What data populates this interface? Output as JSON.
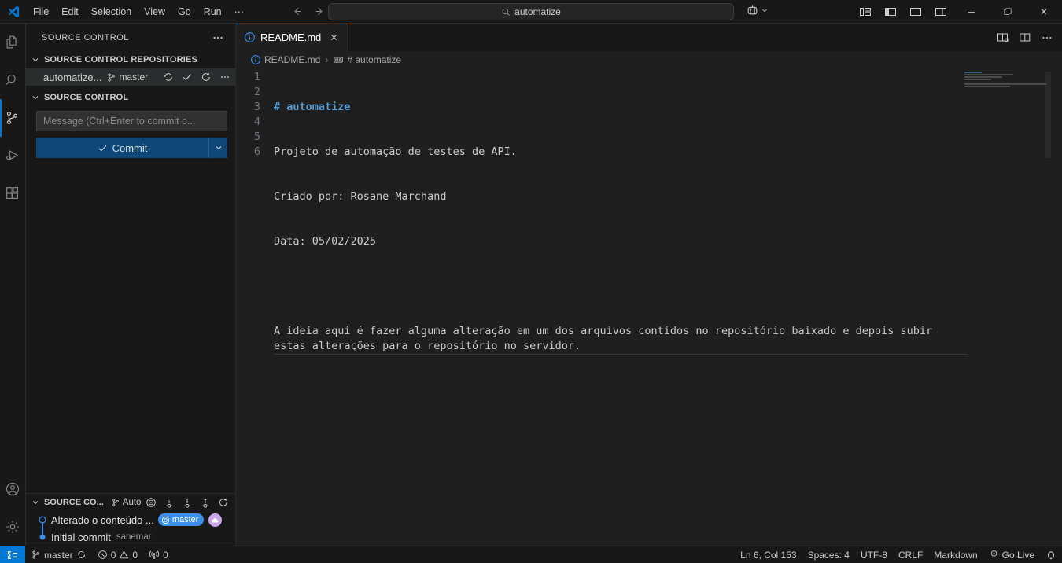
{
  "titlebar": {
    "logo_icon": "vscode-logo-icon",
    "menu": [
      {
        "label": "File"
      },
      {
        "label": "Edit"
      },
      {
        "label": "Selection"
      },
      {
        "label": "View"
      },
      {
        "label": "Go"
      },
      {
        "label": "Run"
      },
      {
        "label": "···"
      }
    ],
    "nav_back_icon": "arrow-left-icon",
    "nav_forward_icon": "arrow-right-icon",
    "command_center": {
      "icon": "search-icon",
      "value": "automatize",
      "placeholder": "Search"
    },
    "accounts_icon": "remote-explorer-icon",
    "accounts_chevron_icon": "chevron-down-icon",
    "layout_buttons": [
      {
        "name": "toggle-panel-layout-icon"
      },
      {
        "name": "toggle-primary-sidebar-icon"
      },
      {
        "name": "toggle-panel-icon"
      },
      {
        "name": "toggle-secondary-sidebar-icon"
      }
    ],
    "window_controls": [
      {
        "name": "minimize-button",
        "glyph": "─"
      },
      {
        "name": "maximize-button",
        "glyph": "❐"
      },
      {
        "name": "close-button",
        "glyph": "✕"
      }
    ]
  },
  "activitybar": {
    "items": [
      {
        "name": "explorer",
        "icon": "files-icon",
        "active": false
      },
      {
        "name": "search",
        "icon": "search-icon",
        "active": false
      },
      {
        "name": "source-control",
        "icon": "source-control-icon",
        "active": true
      },
      {
        "name": "run-and-debug",
        "icon": "debug-icon",
        "active": false
      },
      {
        "name": "extensions",
        "icon": "extensions-icon",
        "active": false
      }
    ],
    "bottom": [
      {
        "name": "accounts",
        "icon": "account-icon"
      },
      {
        "name": "manage",
        "icon": "gear-icon"
      }
    ]
  },
  "sidebar": {
    "title": "SOURCE CONTROL",
    "title_more_icon": "ellipsis-icon",
    "repositories_section": {
      "label": "SOURCE CONTROL REPOSITORIES",
      "chevron_icon": "chevron-down-icon",
      "repo": {
        "name": "automatize...",
        "branch": "master",
        "branch_icon": "git-branch-icon",
        "actions": [
          {
            "name": "sync-changes-icon"
          },
          {
            "name": "commit-check-icon"
          },
          {
            "name": "refresh-icon"
          },
          {
            "name": "more-actions-icon"
          }
        ]
      }
    },
    "scm_section": {
      "label": "SOURCE CONTROL",
      "chevron_icon": "chevron-down-icon",
      "message_placeholder": "Message (Ctrl+Enter to commit o...",
      "message_value": "",
      "commit_label": "Commit",
      "commit_check_icon": "check-icon",
      "commit_dropdown_icon": "chevron-down-icon"
    },
    "graph_section": {
      "label": "SOURCE CO...",
      "chevron_icon": "chevron-down-icon",
      "branch_icon": "git-branch-icon",
      "branch_label": "Auto",
      "tools": [
        {
          "name": "target-icon"
        },
        {
          "name": "fetch-icon"
        },
        {
          "name": "pull-icon"
        },
        {
          "name": "push-icon"
        },
        {
          "name": "refresh-icon"
        }
      ],
      "commits": [
        {
          "message": "Alterado o conteúdo ...",
          "ref": "master",
          "ref_icon": "target-icon",
          "ref_color": "#3b8eea",
          "avatar_color": "#cba6e8",
          "avatar_icon": "cloud-icon",
          "author": "",
          "node": "outline"
        },
        {
          "message": "Initial commit",
          "ref": "",
          "author": "sanemar",
          "node": "filled"
        }
      ]
    }
  },
  "editor": {
    "tabs": [
      {
        "label": "README.md",
        "icon": "markdown-info-icon",
        "close_icon": "close-icon",
        "active": true
      }
    ],
    "tabbar_actions": [
      {
        "name": "split-editor-right-icon"
      },
      {
        "name": "open-changes-icon"
      },
      {
        "name": "more-actions-icon"
      }
    ],
    "breadcrumb": [
      {
        "label": "README.md",
        "icon": "markdown-info-icon"
      },
      {
        "label": "# automatize",
        "icon": "symbol-string-icon"
      }
    ],
    "breadcrumb_separator": "›",
    "lines": [
      {
        "number": "1",
        "text": "# automatize",
        "style": "heading"
      },
      {
        "number": "2",
        "text": "Projeto de automação de testes de API.",
        "style": "plain"
      },
      {
        "number": "3",
        "text": "Criado por: Rosane Marchand",
        "style": "plain"
      },
      {
        "number": "4",
        "text": "Data: 05/02/2025",
        "style": "plain"
      },
      {
        "number": "5",
        "text": "",
        "style": "plain"
      },
      {
        "number": "6",
        "text": "A ideia aqui é fazer alguma alteração em um dos arquivos contidos no repositório baixado e depois subir estas alterações para o repositório no servidor.",
        "style": "wrapped"
      }
    ]
  },
  "statusbar": {
    "remote_icon": "remote-window-icon",
    "left": [
      {
        "name": "branch",
        "icon": "git-branch-icon",
        "label": "master",
        "trailing_icon": "sync-icon"
      },
      {
        "name": "problems",
        "icon": "error-icon",
        "label": "0",
        "icon2": "warning-icon",
        "label2": "0"
      },
      {
        "name": "ports",
        "icon": "radio-tower-icon",
        "label": "0"
      }
    ],
    "right": [
      {
        "name": "cursor-position",
        "label": "Ln 6, Col 153"
      },
      {
        "name": "indentation",
        "label": "Spaces: 4"
      },
      {
        "name": "encoding",
        "label": "UTF-8"
      },
      {
        "name": "eol",
        "label": "CRLF"
      },
      {
        "name": "language-mode",
        "label": "Markdown"
      },
      {
        "name": "go-live",
        "label": "Go Live",
        "icon": "broadcast-icon"
      },
      {
        "name": "notifications",
        "label": "",
        "icon": "bell-icon"
      }
    ]
  },
  "colors": {
    "accent": "#0078d4",
    "commit_button": "#0e4777",
    "heading": "#569cd6",
    "ref_badge": "#3b8eea",
    "background": "#1f1f1f",
    "chrome": "#181818"
  }
}
